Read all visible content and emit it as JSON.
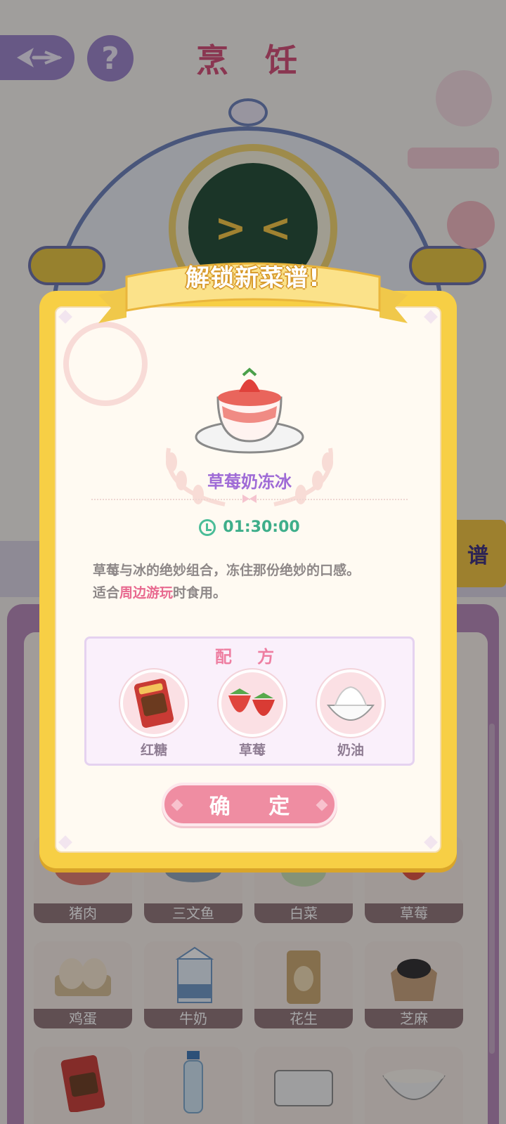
{
  "header": {
    "title": "烹 饪",
    "back_icon": "back-arrow-icon",
    "help_label": "?"
  },
  "robot": {
    "face": "> <"
  },
  "side_tab": {
    "label": "谱"
  },
  "shelf": {
    "row1": [
      "猪肉",
      "三文鱼",
      "白菜",
      "草莓"
    ],
    "row2": [
      "鸡蛋",
      "牛奶",
      "花生",
      "芝麻"
    ],
    "row3": [
      "",
      "",
      "",
      ""
    ]
  },
  "popup": {
    "banner": "解锁新菜谱!",
    "dish_name": "草莓奶冻冰",
    "timer": "01:30:00",
    "description_1": "草莓与冰的绝妙组合，冻住那份绝妙的口感。",
    "description_2_prefix": "适合",
    "description_2_highlight": "周边游玩",
    "description_2_suffix": "时食用。",
    "formula_title": "配 方",
    "ingredients": [
      {
        "label": "红糖",
        "icon": "brown-sugar-icon"
      },
      {
        "label": "草莓",
        "icon": "strawberry-icon"
      },
      {
        "label": "奶油",
        "icon": "cream-icon"
      }
    ],
    "confirm_label": "确 定"
  },
  "colors": {
    "accent_pink": "#ef8da2",
    "accent_purple": "#9f6bd6",
    "frame_yellow": "#f7cf45",
    "timer_green": "#3eae8a"
  }
}
